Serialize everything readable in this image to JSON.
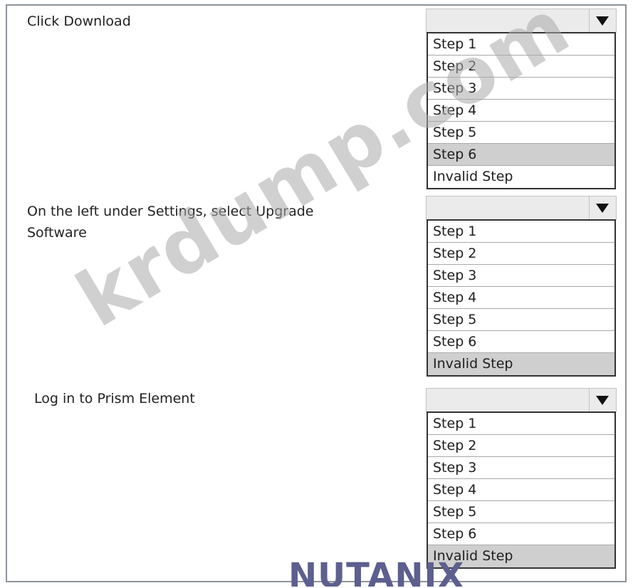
{
  "questions": [
    {
      "statement": "Click Download",
      "options": [
        "Step 1",
        "Step 2",
        "Step 3",
        "Step 4",
        "Step 5",
        "Step 6",
        "Invalid Step"
      ],
      "selected": "Step 6"
    },
    {
      "statement": "On the left under Settings, select Upgrade Software",
      "options": [
        "Step 1",
        "Step 2",
        "Step 3",
        "Step 4",
        "Step 5",
        "Step 6",
        "Invalid Step"
      ],
      "selected": "Invalid Step"
    },
    {
      "statement": "Log in to Prism Element",
      "options": [
        "Step 1",
        "Step 2",
        "Step 3",
        "Step 4",
        "Step 5",
        "Step 6",
        "Invalid Step"
      ],
      "selected": "Invalid Step"
    }
  ],
  "watermark": "krdump.com",
  "logo": "NUTANIX",
  "icons": {
    "dropdown": "triangle-down-icon"
  },
  "colors": {
    "selected_option_bg": "#cfcfcf",
    "dropdown_bg": "#ebebeb",
    "logo": "#5d5f8e"
  }
}
